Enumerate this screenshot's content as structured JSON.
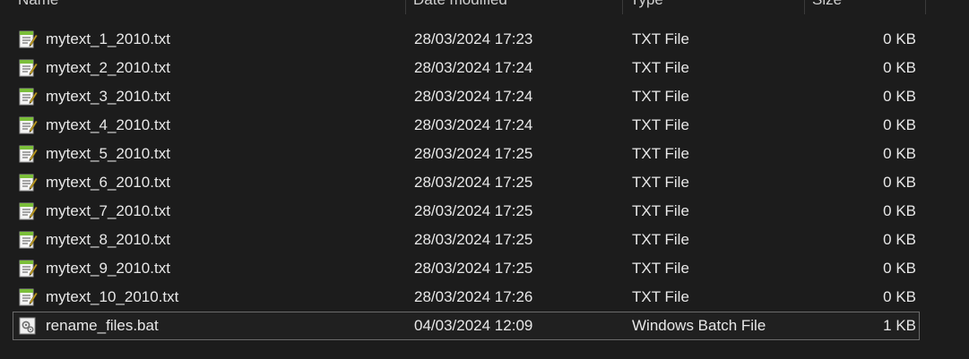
{
  "columns": {
    "name": "Name",
    "date": "Date modified",
    "type": "Type",
    "size": "Size"
  },
  "files": [
    {
      "name": "mytext_1_2010.txt",
      "date": "28/03/2024 17:23",
      "type": "TXT File",
      "size": "0 KB",
      "icon": "text-file-icon"
    },
    {
      "name": "mytext_2_2010.txt",
      "date": "28/03/2024 17:24",
      "type": "TXT File",
      "size": "0 KB",
      "icon": "text-file-icon"
    },
    {
      "name": "mytext_3_2010.txt",
      "date": "28/03/2024 17:24",
      "type": "TXT File",
      "size": "0 KB",
      "icon": "text-file-icon"
    },
    {
      "name": "mytext_4_2010.txt",
      "date": "28/03/2024 17:24",
      "type": "TXT File",
      "size": "0 KB",
      "icon": "text-file-icon"
    },
    {
      "name": "mytext_5_2010.txt",
      "date": "28/03/2024 17:25",
      "type": "TXT File",
      "size": "0 KB",
      "icon": "text-file-icon"
    },
    {
      "name": "mytext_6_2010.txt",
      "date": "28/03/2024 17:25",
      "type": "TXT File",
      "size": "0 KB",
      "icon": "text-file-icon"
    },
    {
      "name": "mytext_7_2010.txt",
      "date": "28/03/2024 17:25",
      "type": "TXT File",
      "size": "0 KB",
      "icon": "text-file-icon"
    },
    {
      "name": "mytext_8_2010.txt",
      "date": "28/03/2024 17:25",
      "type": "TXT File",
      "size": "0 KB",
      "icon": "text-file-icon"
    },
    {
      "name": "mytext_9_2010.txt",
      "date": "28/03/2024 17:25",
      "type": "TXT File",
      "size": "0 KB",
      "icon": "text-file-icon"
    },
    {
      "name": "mytext_10_2010.txt",
      "date": "28/03/2024 17:26",
      "type": "TXT File",
      "size": "0 KB",
      "icon": "text-file-icon"
    },
    {
      "name": "rename_files.bat",
      "date": "04/03/2024 12:09",
      "type": "Windows Batch File",
      "size": "1 KB",
      "icon": "batch-file-icon",
      "selected": true
    }
  ],
  "colors": {
    "background": "#1c1c1c",
    "text": "#e8e8e8",
    "selection_border": "#6b6b6b",
    "notepad_green": "#7bbf3a"
  }
}
